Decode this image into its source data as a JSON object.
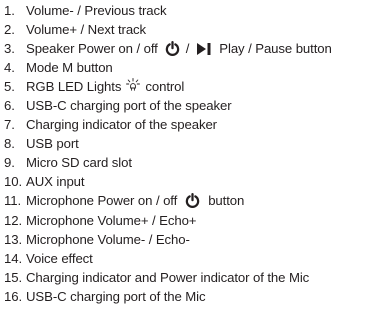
{
  "items": [
    {
      "num": "1.",
      "text": "Volume- / Previous track"
    },
    {
      "num": "2.",
      "text": "Volume+ / Next track"
    },
    {
      "num": "3.",
      "text_a": "Speaker Power on / off",
      "text_b": "/",
      "text_c": "Play / Pause button"
    },
    {
      "num": "4.",
      "text": "Mode M button"
    },
    {
      "num": "5.",
      "text_a": "RGB LED Lights",
      "text_b": "control"
    },
    {
      "num": "6.",
      "text": "USB-C charging port of the speaker"
    },
    {
      "num": "7.",
      "text": "Charging indicator of the speaker"
    },
    {
      "num": "8.",
      "text": "USB port"
    },
    {
      "num": "9.",
      "text": "Micro SD card slot"
    },
    {
      "num": "10.",
      "text": "AUX input"
    },
    {
      "num": "11.",
      "text_a": "Microphone Power on / off",
      "text_b": "button"
    },
    {
      "num": "12.",
      "text": "Microphone Volume+ / Echo+"
    },
    {
      "num": "13.",
      "text": "Microphone Volume- / Echo-"
    },
    {
      "num": "14.",
      "text": "Voice effect"
    },
    {
      "num": "15.",
      "text": "Charging indicator and Power indicator of the Mic"
    },
    {
      "num": "16.",
      "text": "USB-C charging port of the Mic"
    }
  ],
  "icons": {
    "power": "power-icon",
    "play_pause": "play-pause-icon",
    "led": "led-light-icon"
  },
  "colors": {
    "text": "#231f20",
    "background": "#ffffff"
  }
}
